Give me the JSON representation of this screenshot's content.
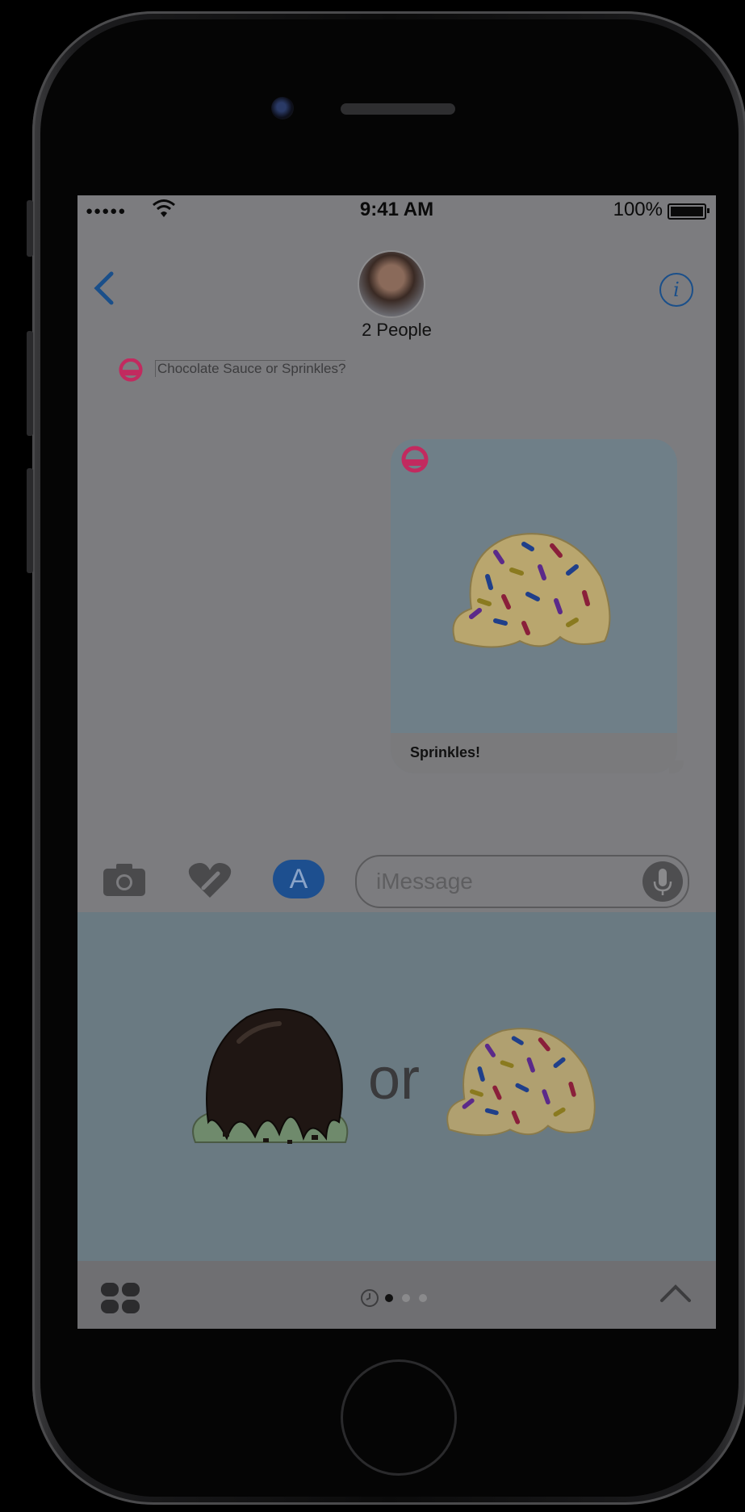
{
  "status_bar": {
    "carrier": "●●●●●",
    "time": "9:41 AM",
    "battery_percent": "100%"
  },
  "nav": {
    "back_icon": "chevron-left-icon",
    "contact_title": "2 People",
    "info_icon": "info-icon",
    "info_glyph": "i"
  },
  "thread": {
    "message_text": "Chocolate Sauce or Sprinkles?",
    "bubble_caption": "Sprinkles!"
  },
  "composer": {
    "placeholder": "iMessage",
    "app_store_glyph": "A"
  },
  "panel": {
    "or_label": "or"
  },
  "page_dots": {
    "count": 3,
    "active": 0
  },
  "colors": {
    "accent": "#1d4f8f",
    "app_brand": "#c22a5f",
    "screen_dim": "#7c7c7f",
    "panel_bg": "#6a7a82"
  }
}
